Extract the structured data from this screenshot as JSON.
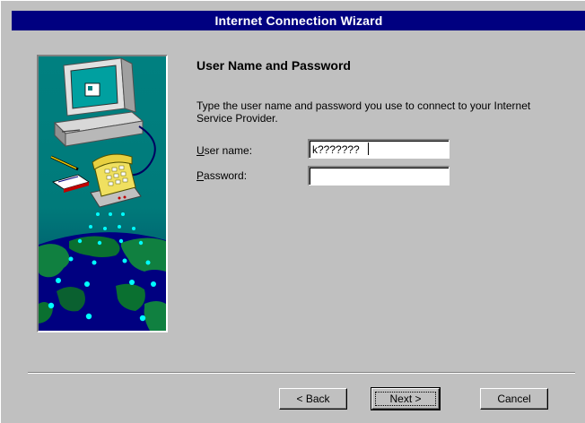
{
  "window": {
    "title": "Internet Connection Wizard"
  },
  "page": {
    "heading": "User Name and Password",
    "description": "Type the user name and password you use to connect to your Internet Service Provider."
  },
  "fields": {
    "username": {
      "label_accel": "U",
      "label_rest": "ser name:",
      "value": "k???????"
    },
    "password": {
      "label_accel": "P",
      "label_rest": "assword:",
      "value": ""
    }
  },
  "buttons": {
    "back": "< Back",
    "next": "Next >",
    "cancel": "Cancel"
  },
  "illustration": {
    "icons": [
      "computer-icon",
      "telephone-icon",
      "envelope-icon",
      "pencil-icon",
      "globe-icon"
    ]
  },
  "colors": {
    "titlebar": "#000080",
    "illustration_bg": "#008080",
    "face": "#c0c0c0"
  }
}
